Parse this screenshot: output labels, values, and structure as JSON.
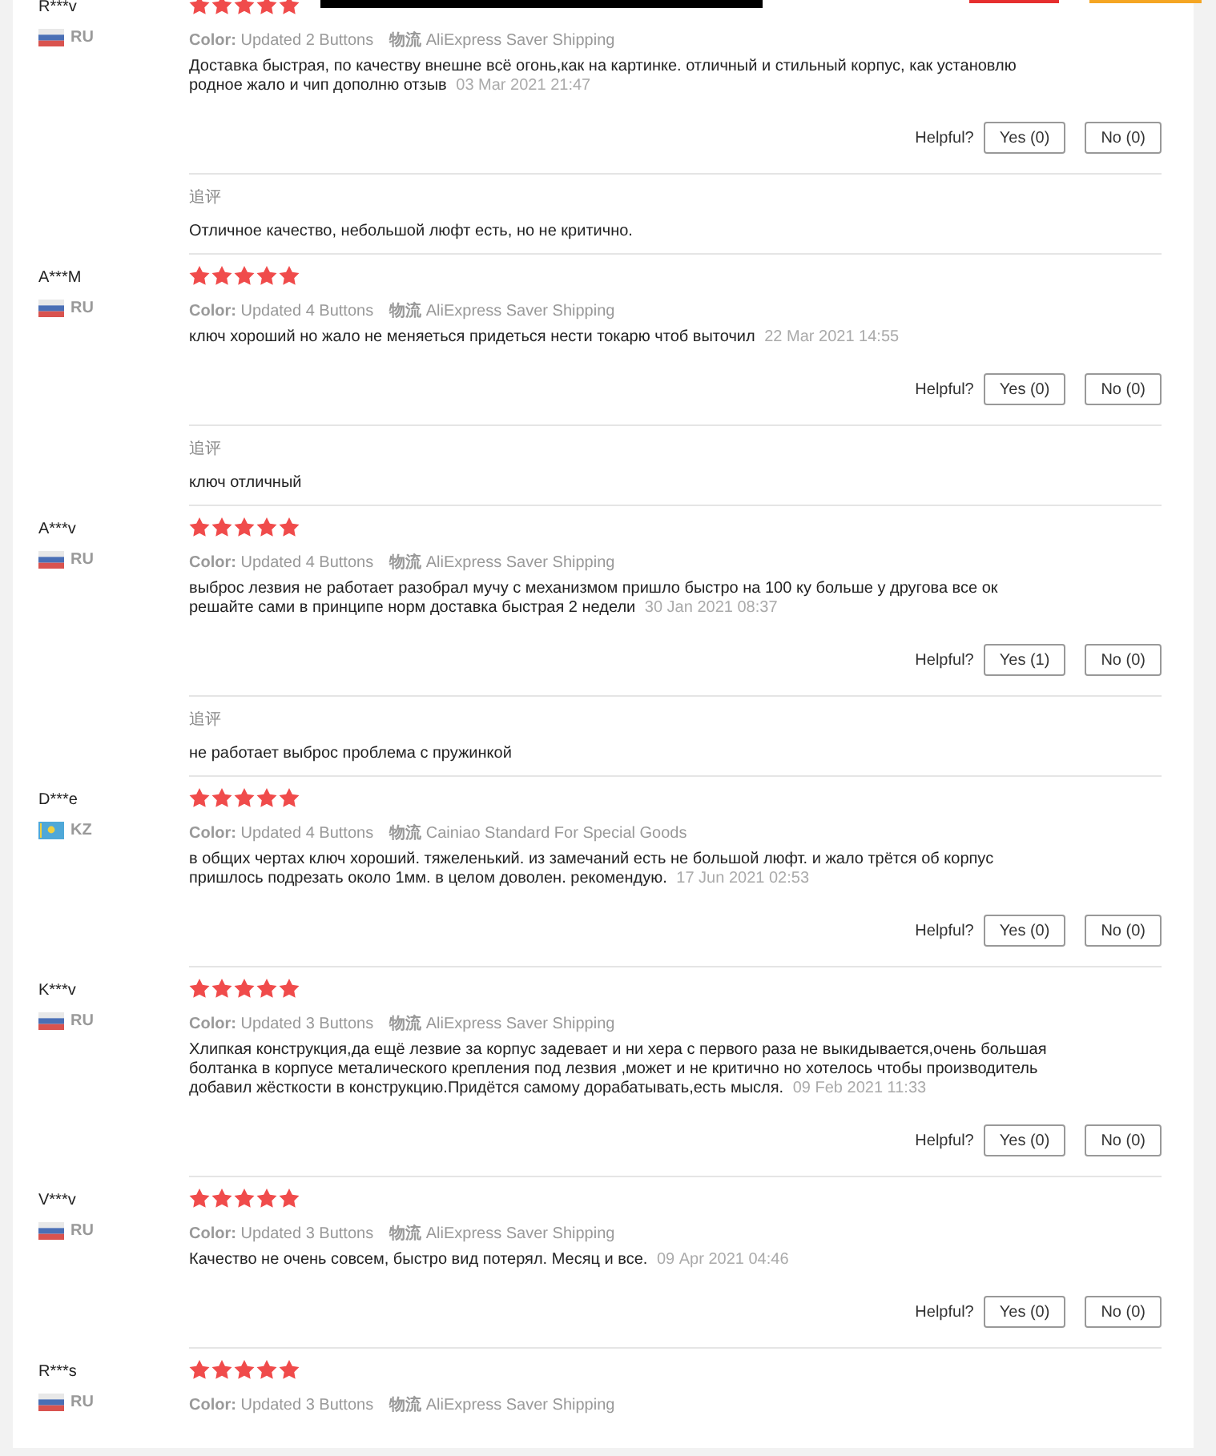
{
  "reviews": [
    {
      "name": "R***v",
      "country": "RU",
      "kind": "ru",
      "stars": 5,
      "color_label": "Color:",
      "color_value": "Updated 2 Buttons",
      "shipping_label": "物流",
      "shipping": "AliExpress Saver Shipping",
      "text": "Доставка быстрая, по качеству внешне всё огонь,как на картинке. отличный и стильный корпус, как установлю родное жало и чип дополню отзыв",
      "date": "03 Mar 2021 21:47",
      "helpful_label": "Helpful?",
      "yes": "Yes (0)",
      "no": "No (0)",
      "follow_up": {
        "label": "追评",
        "text": "Отличное качество, небольшой люфт есть, но не критично."
      }
    },
    {
      "name": "A***M",
      "country": "RU",
      "kind": "ru",
      "stars": 5,
      "color_label": "Color:",
      "color_value": "Updated 4 Buttons",
      "shipping_label": "物流",
      "shipping": "AliExpress Saver Shipping",
      "text": "ключ хороший но жало не меняеться придеться нести токарю чтоб выточил",
      "date": "22 Mar 2021 14:55",
      "helpful_label": "Helpful?",
      "yes": "Yes (0)",
      "no": "No (0)",
      "follow_up": {
        "label": "追评",
        "text": "ключ отличный"
      }
    },
    {
      "name": "A***v",
      "country": "RU",
      "kind": "ru",
      "stars": 5,
      "color_label": "Color:",
      "color_value": "Updated 4 Buttons",
      "shipping_label": "物流",
      "shipping": "AliExpress Saver Shipping",
      "text": "выброс лезвия не работает разобрал мучу с механизмом пришло быстро на 100 ку больше у другова все ок решайте сами в принципе норм доставка быстрая 2 недели",
      "date": "30 Jan 2021 08:37",
      "helpful_label": "Helpful?",
      "yes": "Yes (1)",
      "no": "No (0)",
      "follow_up": {
        "label": "追评",
        "text": "не работает выброс проблема с пружинкой"
      }
    },
    {
      "name": "D***e",
      "country": "KZ",
      "kind": "kz",
      "stars": 5,
      "color_label": "Color:",
      "color_value": "Updated 4 Buttons",
      "shipping_label": "物流",
      "shipping": "Cainiao Standard For Special Goods",
      "text": "в общих чертах ключ хороший. тяжеленький. из замечаний есть не большой люфт. и жало трётся об корпус пришлось подрезать около 1мм. в целом доволен. рекомендую.",
      "date": "17 Jun 2021 02:53",
      "helpful_label": "Helpful?",
      "yes": "Yes (0)",
      "no": "No (0)"
    },
    {
      "name": "K***v",
      "country": "RU",
      "kind": "ru",
      "stars": 5,
      "color_label": "Color:",
      "color_value": "Updated 3 Buttons",
      "shipping_label": "物流",
      "shipping": "AliExpress Saver Shipping",
      "text": "Хлипкая конструкция,да ещё лезвие за корпус задевает и ни хера с первого раза не выкидывается,очень большая болтанка в корпусе металического крепления под лезвия ,может и не критично но хотелось чтобы производитель добавил жёсткости в конструкцию.Придётся самому дорабатывать,есть мысля.",
      "date": "09 Feb 2021 11:33",
      "helpful_label": "Helpful?",
      "yes": "Yes (0)",
      "no": "No (0)"
    },
    {
      "name": "V***v",
      "country": "RU",
      "kind": "ru",
      "stars": 5,
      "color_label": "Color:",
      "color_value": "Updated 3 Buttons",
      "shipping_label": "物流",
      "shipping": "AliExpress Saver Shipping",
      "text": "Качество не очень совсем, быстро вид потерял. Месяц и все.",
      "date": "09 Apr 2021 04:46",
      "helpful_label": "Helpful?",
      "yes": "Yes (0)",
      "no": "No (0)"
    },
    {
      "name": "R***s",
      "country": "RU",
      "kind": "ru",
      "stars": 5,
      "color_label": "Color:",
      "color_value": "Updated 3 Buttons",
      "shipping_label": "物流",
      "shipping": "AliExpress Saver Shipping"
    }
  ]
}
